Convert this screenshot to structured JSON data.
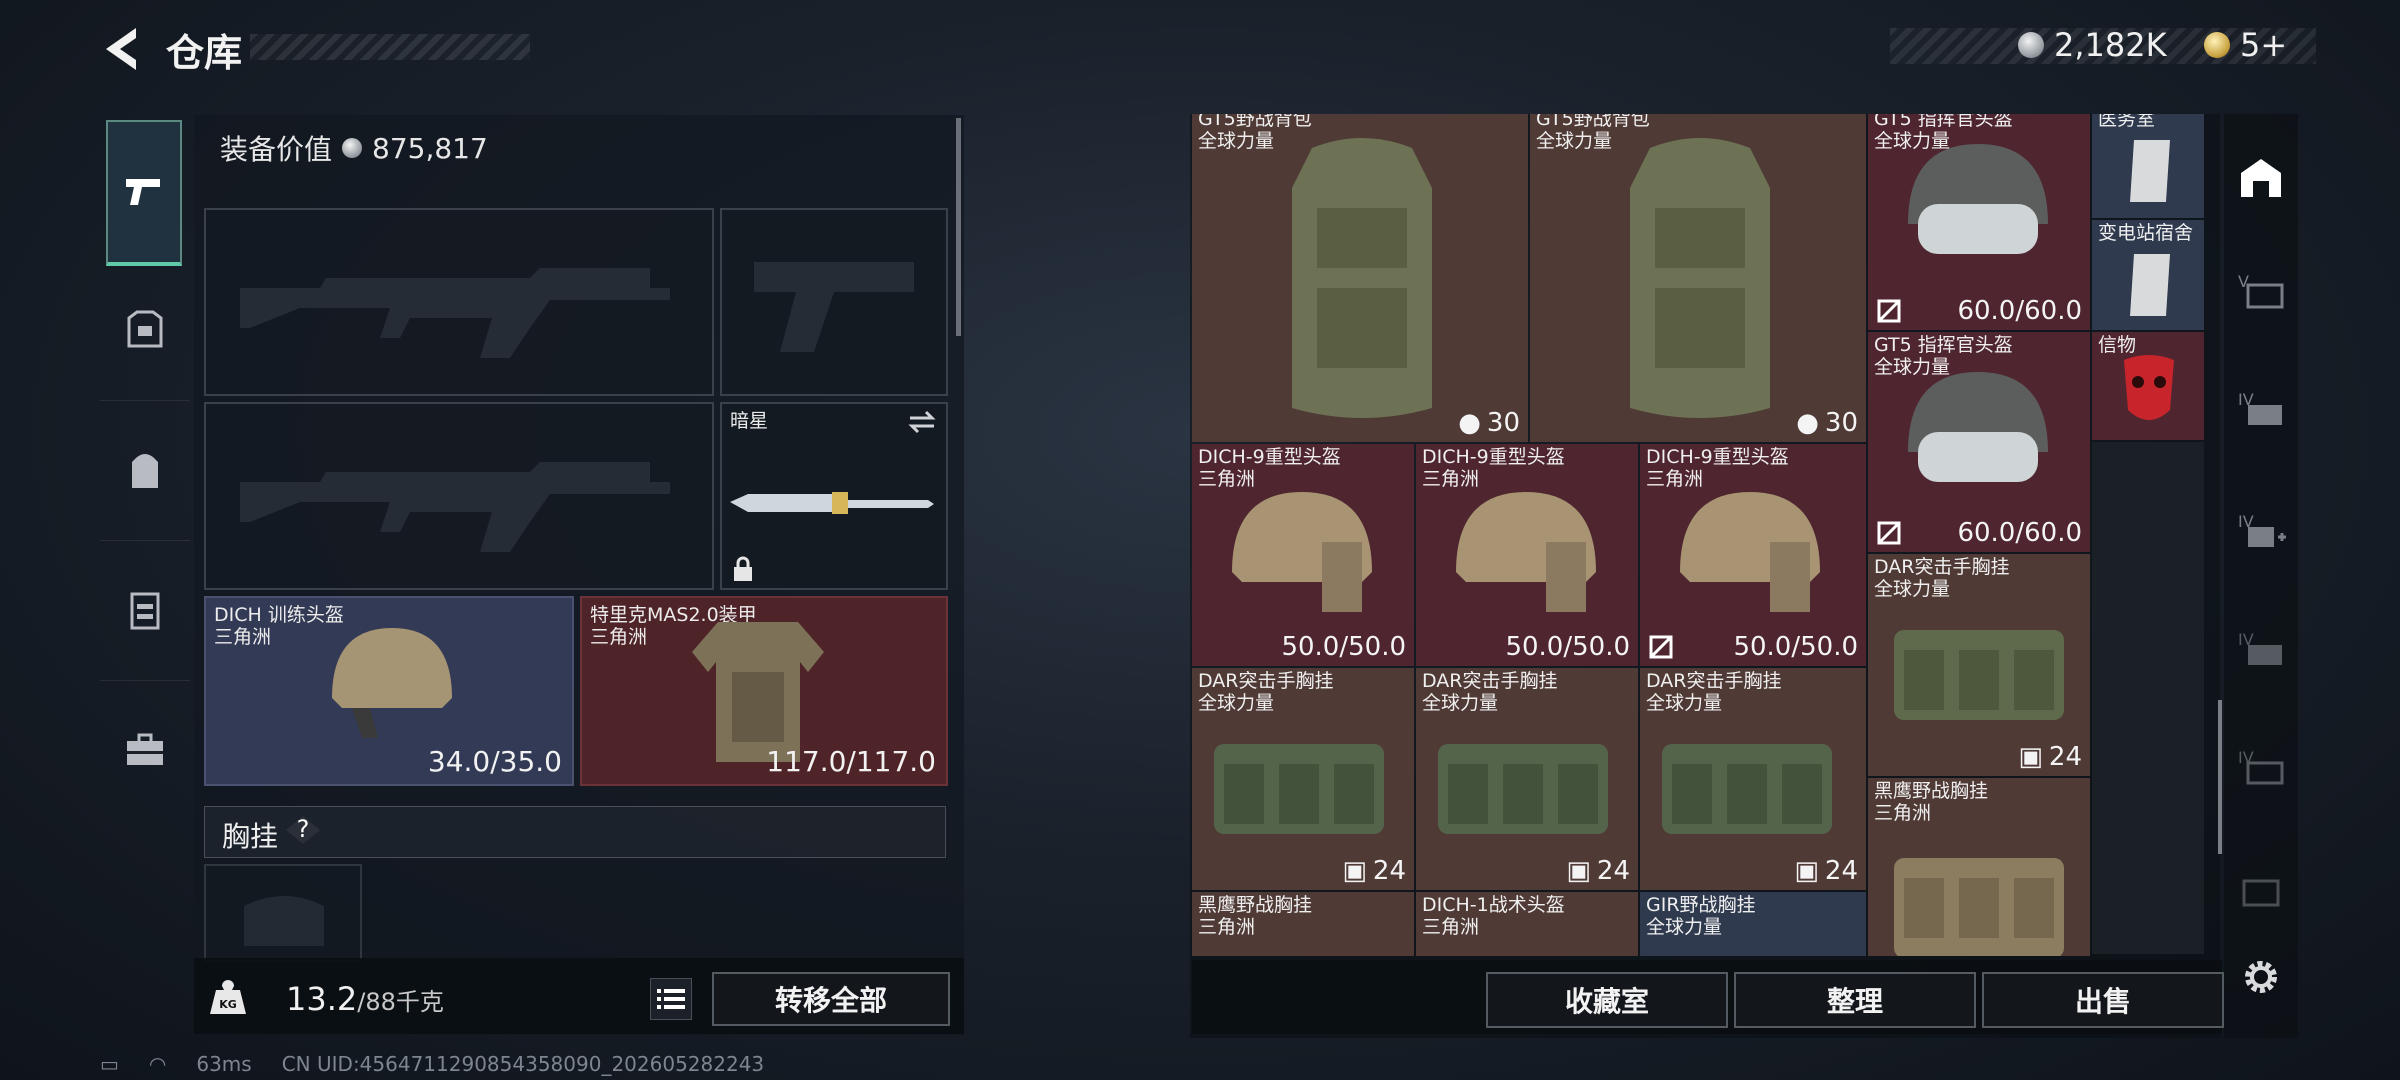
{
  "header": {
    "title": "仓库",
    "currency_silver": "2,182K",
    "currency_gold": "5+"
  },
  "left": {
    "equip_value_label": "装备价值",
    "equip_value": "875,817",
    "tabs": [
      "pistol-icon",
      "armor-icon",
      "backpack-icon",
      "chest-rig-icon",
      "case-icon"
    ],
    "melee_label": "暗星",
    "helmet": {
      "name": "DICH 训练头盔",
      "faction": "三角洲",
      "durability": "34.0/35.0"
    },
    "armor": {
      "name": "特里克MAS2.0装甲",
      "faction": "三角洲",
      "durability": "117.0/117.0"
    },
    "chest_rig_label": "胸挂",
    "chest_rig_help": "?",
    "weight": "13.2",
    "weight_max": "/88千克",
    "transfer_all": "转移全部"
  },
  "grid": {
    "backpack1": {
      "name": "GT5野战背包",
      "sub": "全球力量",
      "cap": "30"
    },
    "backpack2": {
      "name": "GT5野战背包",
      "sub": "全球力量",
      "cap": "30"
    },
    "helmet_gt5_1": {
      "name": "GT5 指挥官头盔",
      "sub": "全球力量",
      "val": "60.0/60.0"
    },
    "helmet_gt5_2": {
      "name": "GT5 指挥官头盔",
      "sub": "全球力量",
      "val": "60.0/60.0"
    },
    "key1": {
      "name": "医务室"
    },
    "key2": {
      "name": "变电站宿舍"
    },
    "token": {
      "name": "信物"
    },
    "dich9_1": {
      "name": "DICH-9重型头盔",
      "sub": "三角洲",
      "val": "50.0/50.0"
    },
    "dich9_2": {
      "name": "DICH-9重型头盔",
      "sub": "三角洲",
      "val": "50.0/50.0"
    },
    "dich9_3": {
      "name": "DICH-9重型头盔",
      "sub": "三角洲",
      "val": "50.0/50.0"
    },
    "dar1": {
      "name": "DAR突击手胸挂",
      "sub": "全球力量",
      "cap": "24"
    },
    "dar2": {
      "name": "DAR突击手胸挂",
      "sub": "全球力量",
      "cap": "24"
    },
    "dar3": {
      "name": "DAR突击手胸挂",
      "sub": "全球力量",
      "cap": "24"
    },
    "dar4": {
      "name": "DAR突击手胸挂",
      "sub": "全球力量",
      "cap": "24"
    },
    "blackhawk1": {
      "name": "黑鹰野战胸挂",
      "sub": "三角洲"
    },
    "blackhawk2": {
      "name": "黑鹰野战胸挂",
      "sub": "三角洲"
    },
    "dich1": {
      "name": "DICH-1战术头盔",
      "sub": "三角洲"
    },
    "gir": {
      "name": "GIR野战胸挂",
      "sub": "全球力量"
    }
  },
  "buttons": {
    "collection": "收藏室",
    "organize": "整理",
    "sell": "出售"
  },
  "status": {
    "ping": "63ms",
    "uid": "CN UID:4564711290854358090_202605282243"
  }
}
